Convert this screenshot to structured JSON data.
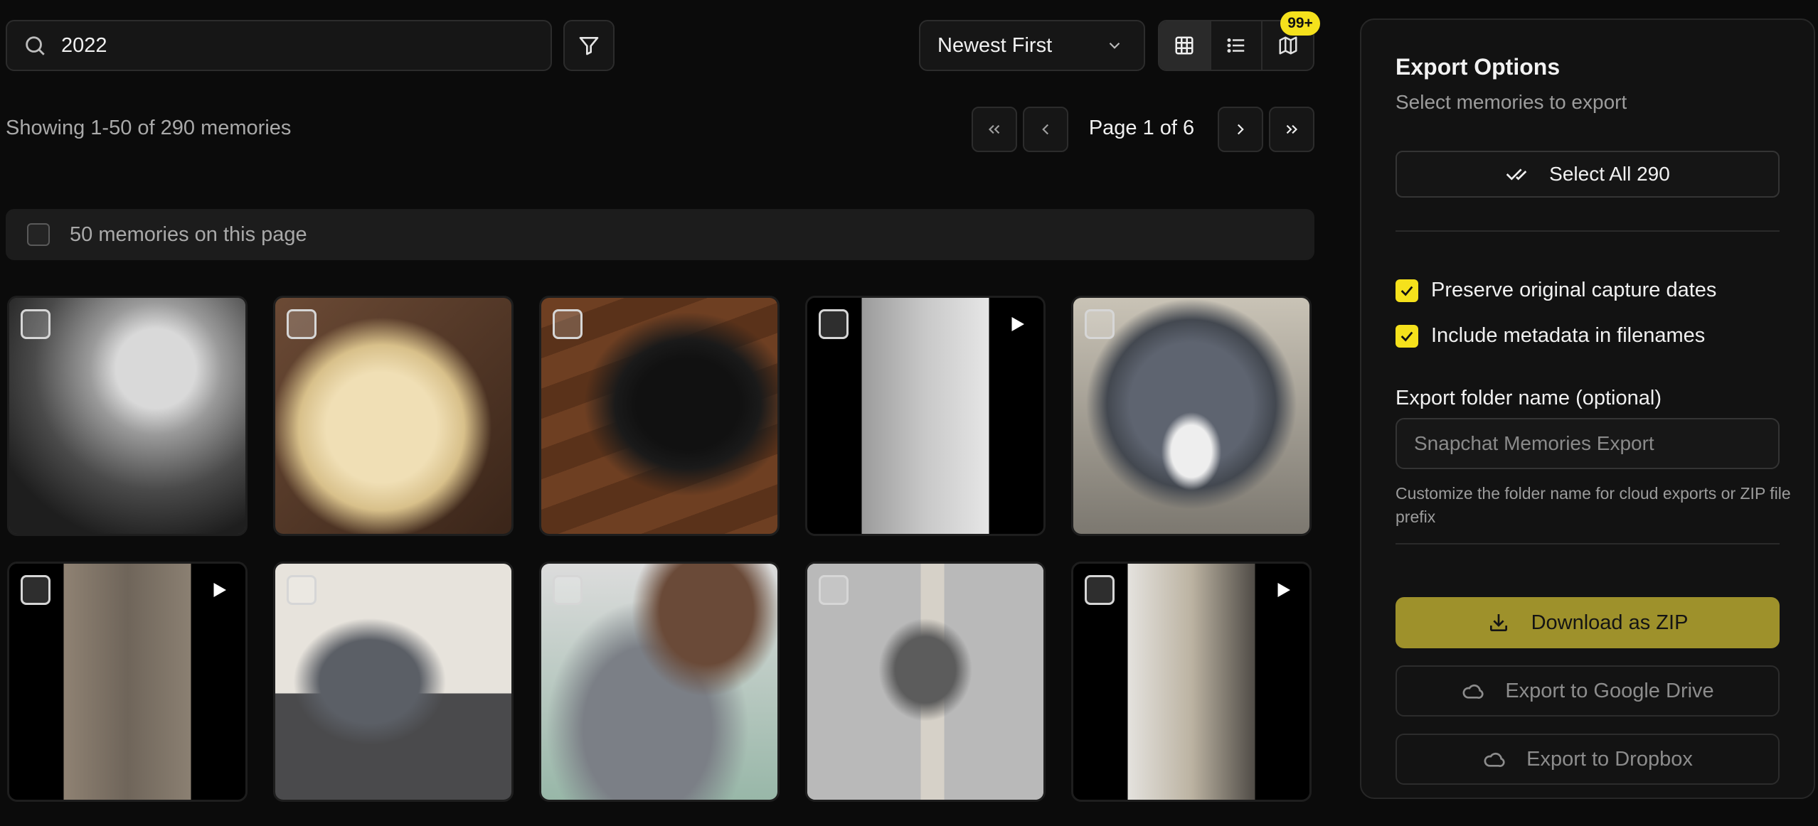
{
  "toolbar": {
    "search_value": "2022",
    "sort_label": "Newest First",
    "badge": "99+"
  },
  "info": {
    "showing": "Showing 1-50 of 290 memories",
    "page_label": "Page 1 of 6"
  },
  "page_select": {
    "label": "50 memories on this page"
  },
  "grid": {
    "tiles": [
      {
        "kind": "photo",
        "video": false
      },
      {
        "kind": "photo",
        "video": false
      },
      {
        "kind": "photo",
        "video": false
      },
      {
        "kind": "photo",
        "video": true
      },
      {
        "kind": "photo",
        "video": false
      },
      {
        "kind": "photo",
        "video": true
      },
      {
        "kind": "photo",
        "video": false
      },
      {
        "kind": "photo",
        "video": false
      },
      {
        "kind": "photo",
        "video": false
      },
      {
        "kind": "photo",
        "video": true
      }
    ]
  },
  "sidebar": {
    "title": "Export Options",
    "subtitle": "Select memories to export",
    "select_all": "Select All 290",
    "options": [
      {
        "label": "Preserve original capture dates",
        "checked": true
      },
      {
        "label": "Include metadata in filenames",
        "checked": true
      }
    ],
    "folder_label": "Export folder name (optional)",
    "folder_placeholder": "Snapchat Memories Export",
    "hint": "Customize the folder name for cloud exports or ZIP file prefix",
    "download_zip": "Download as ZIP",
    "google_drive": "Export to Google Drive",
    "dropbox": "Export to Dropbox"
  },
  "colors": {
    "accent": "#f5e11c",
    "zip_button": "#9e912b",
    "background": "#0b0b0b",
    "panel": "#121212"
  }
}
